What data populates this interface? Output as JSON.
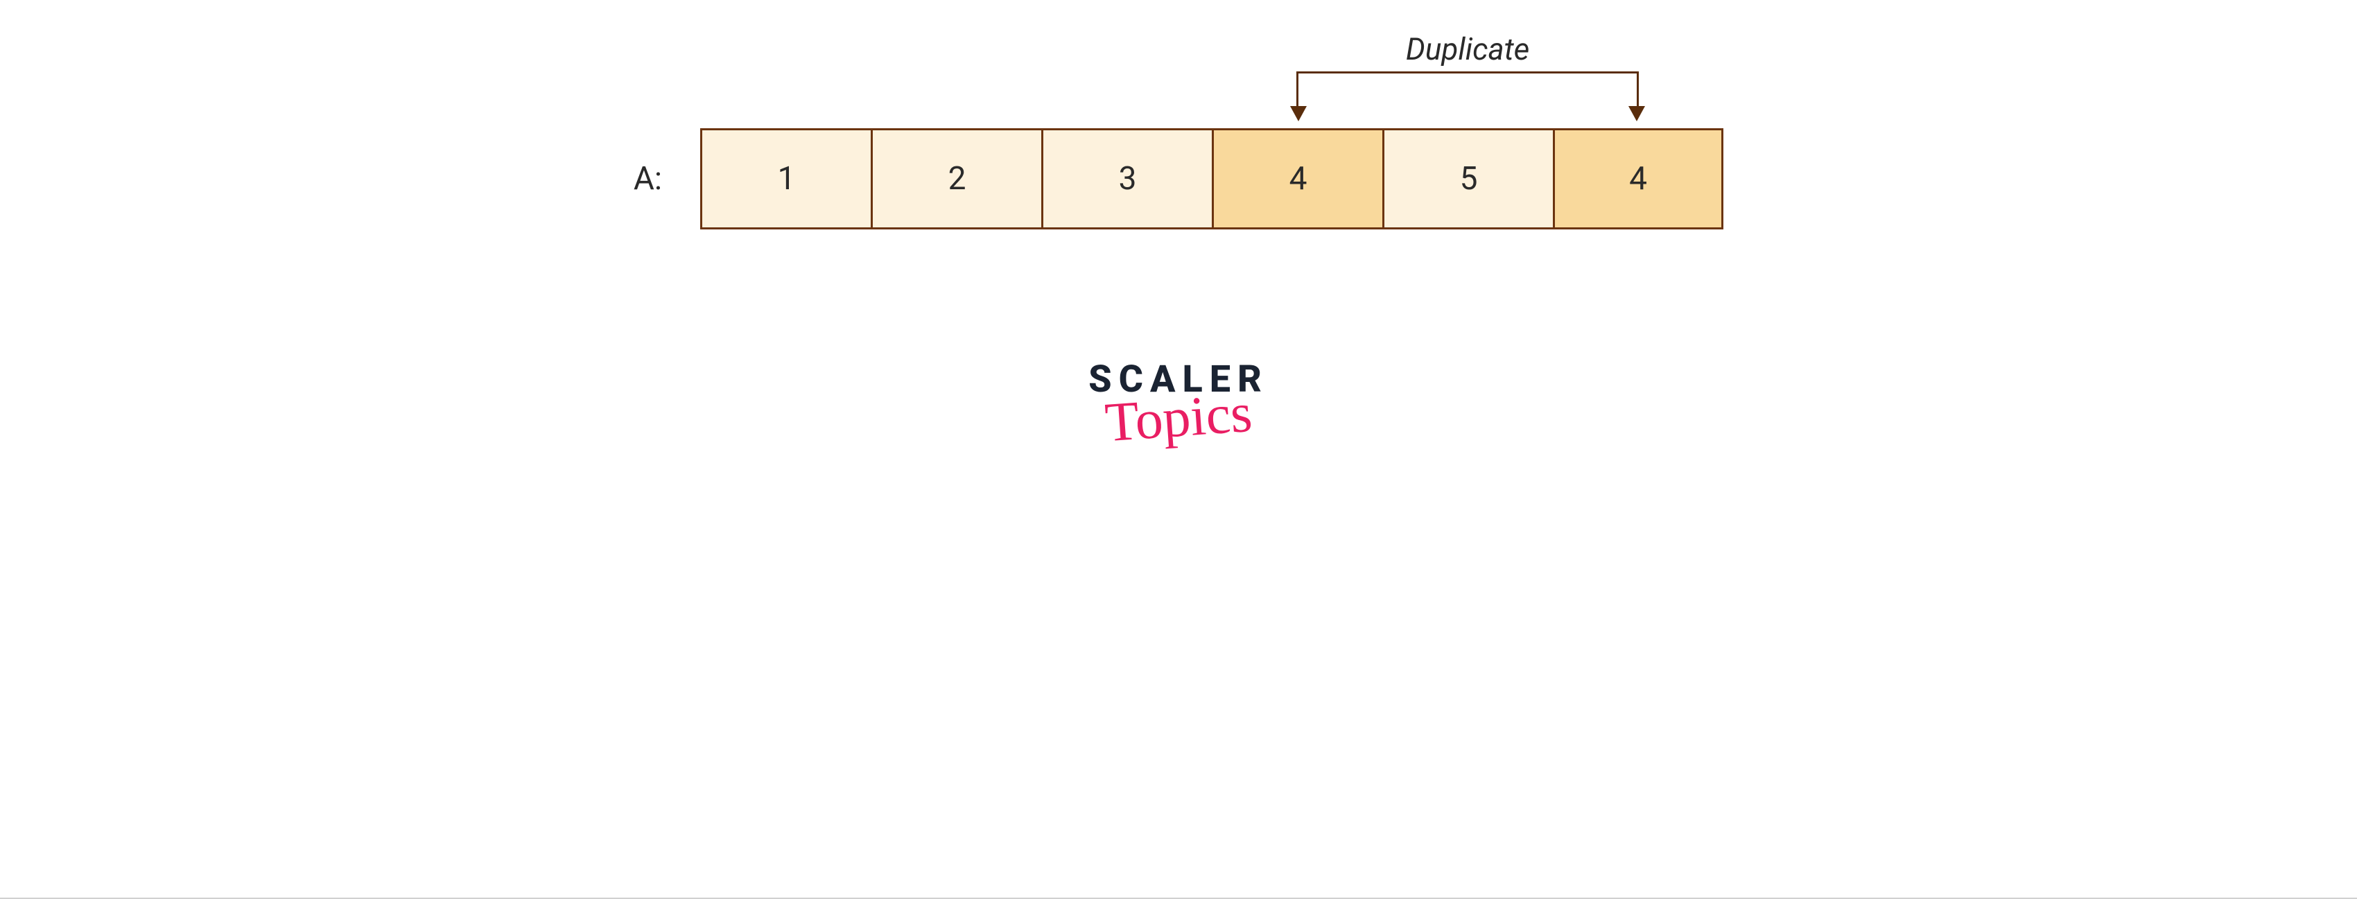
{
  "diagram": {
    "annotation_label": "Duplicate",
    "array_label": "A:",
    "cells": [
      {
        "value": "1",
        "highlight": false
      },
      {
        "value": "2",
        "highlight": false
      },
      {
        "value": "3",
        "highlight": false
      },
      {
        "value": "4",
        "highlight": true
      },
      {
        "value": "5",
        "highlight": false
      },
      {
        "value": "4",
        "highlight": true
      }
    ],
    "bracket_from_index": 3,
    "bracket_to_index": 5
  },
  "logo": {
    "line1": "SCALER",
    "line2": "Topics"
  },
  "colors": {
    "cell_border": "#6b3410",
    "cell_bg_normal": "#fdf2dd",
    "cell_bg_highlight": "#f9d99c",
    "bracket": "#5a2d0c",
    "logo_dark": "#1a2332",
    "logo_pink": "#e91e63"
  }
}
